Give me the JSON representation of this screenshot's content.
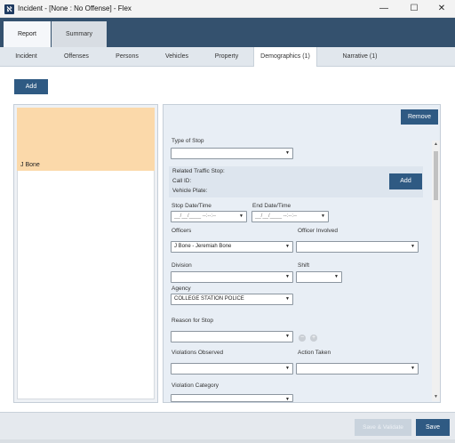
{
  "window": {
    "title": "Incident - [None : No Offense] - Flex",
    "controls": {
      "minimize": "—",
      "maximize": "☐",
      "close": "✕"
    }
  },
  "main_tabs": [
    {
      "label": "Report",
      "active": true
    },
    {
      "label": "Summary",
      "active": false
    }
  ],
  "sub_tabs": [
    {
      "label": "Incident"
    },
    {
      "label": "Offenses"
    },
    {
      "label": "Persons"
    },
    {
      "label": "Vehicles"
    },
    {
      "label": "Property"
    },
    {
      "label": "Demographics (1)",
      "active": true
    },
    {
      "label": "Narrative (1)"
    }
  ],
  "toolbar": {
    "add_label": "Add"
  },
  "persons_list": [
    {
      "name": "J Bone",
      "selected": true
    }
  ],
  "form": {
    "remove_label": "Remove",
    "type_of_stop": {
      "label": "Type of Stop",
      "value": ""
    },
    "related": {
      "traffic_stop_label": "Related Traffic Stop:",
      "call_id_label": "Call ID:",
      "vehicle_plate_label": "Vehicle Plate:",
      "add_label": "Add"
    },
    "stop_datetime": {
      "label": "Stop Date/Time",
      "value": "__/__/____ --:--:--"
    },
    "end_datetime": {
      "label": "End Date/Time",
      "value": "__/__/____ --:--:--"
    },
    "officers": {
      "label": "Officers",
      "value": "J Bone - Jeremiah Bone"
    },
    "officer_involved": {
      "label": "Officer Involved",
      "value": ""
    },
    "division": {
      "label": "Division",
      "value": ""
    },
    "shift": {
      "label": "Shift",
      "value": ""
    },
    "agency": {
      "label": "Agency",
      "value": "COLLEGE STATION POLICE"
    },
    "reason_for_stop": {
      "label": "Reason for Stop",
      "value": ""
    },
    "violations_observed": {
      "label": "Violations Observed",
      "value": ""
    },
    "action_taken": {
      "label": "Action Taken",
      "value": ""
    },
    "violation_category": {
      "label": "Violation Category",
      "value": ""
    }
  },
  "footer": {
    "save_validate_label": "Save & Validate",
    "save_label": "Save"
  },
  "icons": {
    "app": "flex-app-icon",
    "caret": "chevron-down-icon",
    "remove": "minus-circle-icon",
    "add": "plus-circle-icon"
  },
  "colors": {
    "header_bg": "#34516e",
    "primary_button": "#2f5a83",
    "selected_card": "#fbd9aa"
  }
}
